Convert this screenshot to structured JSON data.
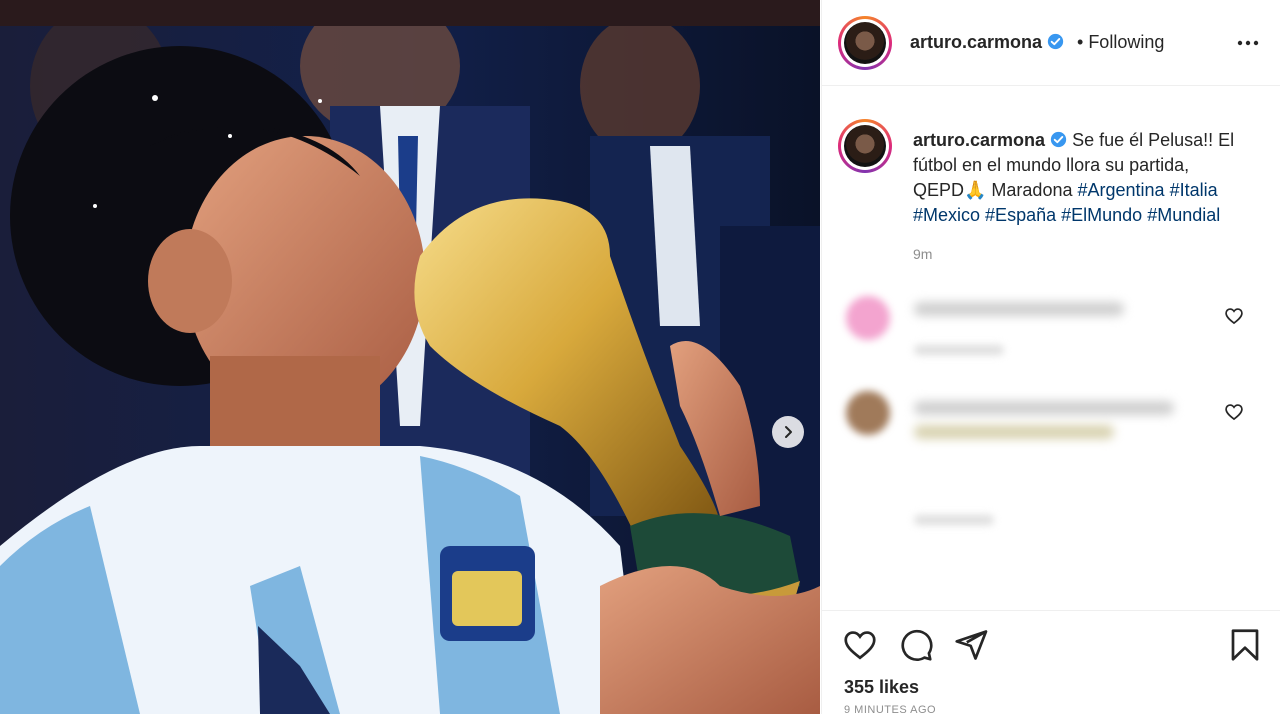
{
  "post": {
    "username": "arturo.carmona",
    "follow_separator": "•",
    "follow_status": "Following",
    "caption": {
      "username": "arturo.carmona",
      "text_line1": "Se fue él Pelusa!! El",
      "text_line2": "fútbol en el mundo llora su partida,",
      "text_line3_plain": "QEPD🙏 Maradona",
      "hashtags_line3": [
        "#Argentina",
        "#Italia"
      ],
      "hashtags_line4": [
        "#Mexico",
        "#España",
        "#ElMundo",
        "#Mundial"
      ],
      "time": "9m"
    },
    "likes": "355 likes",
    "time_ago": "9 MINUTES AGO"
  },
  "icons": {
    "header_more": "more-dots-icon",
    "verified": "verified-badge-icon",
    "carousel_next": "chevron-right-icon",
    "like": "heart-icon",
    "comment": "comment-bubble-icon",
    "share": "paper-plane-icon",
    "save": "bookmark-icon",
    "comment_like": "small-heart-icon"
  },
  "colors": {
    "hashtag": "#00376b",
    "verified": "#3897f0",
    "muted": "#8e8e8e",
    "text": "#262626"
  }
}
